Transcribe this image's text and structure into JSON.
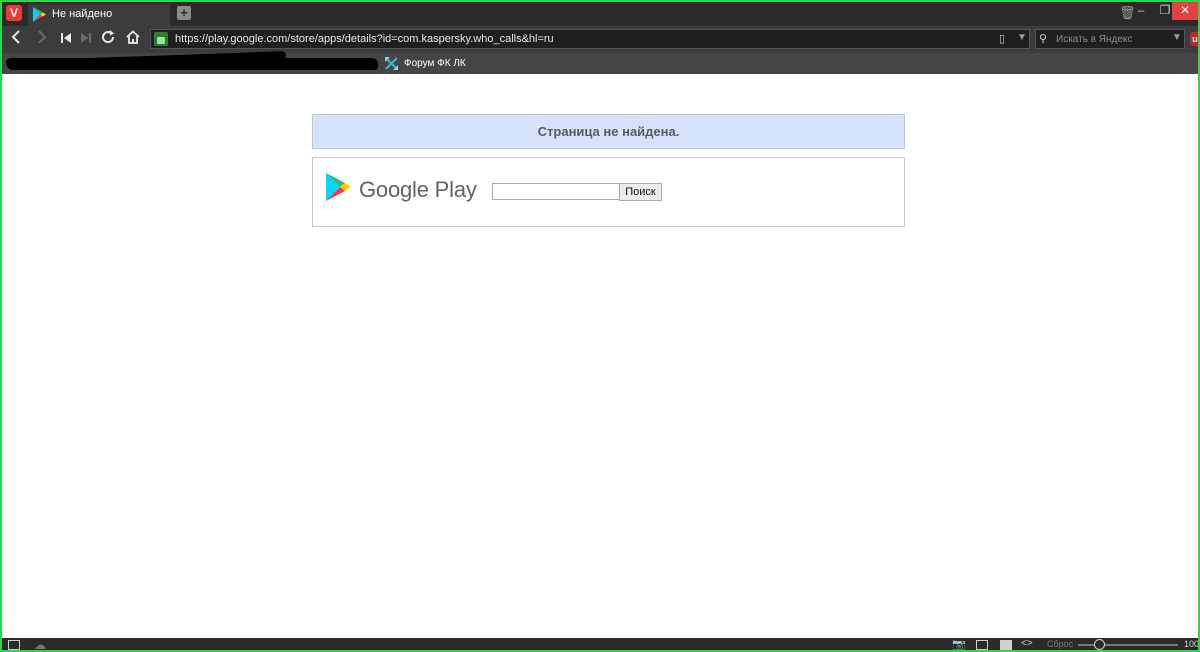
{
  "browser": {
    "logo_letter": "V",
    "tab_title": "Не найдено",
    "new_tab_symbol": "+",
    "url": "https://play.google.com/store/apps/details?id=com.kaspersky.who_calls&hl=ru",
    "search_placeholder": "Искать в Яндекс",
    "extension_badge": "u",
    "window_controls": {
      "minimize": "–",
      "maximize": "❐",
      "close": "✕"
    }
  },
  "bookmarks": {
    "items": [
      {
        "label": "Форум ФК ЛК",
        "icon": "cross-arrows-icon"
      }
    ]
  },
  "page": {
    "notice_text": "Страница не найдена.",
    "brand": "Google Play",
    "search_value": "",
    "search_button": "Поиск"
  },
  "statusbar": {
    "reset_label": "Сброс",
    "zoom_level": "100"
  },
  "colors": {
    "frame_border": "#2fd54a",
    "notice_bg": "#d7e3fb",
    "close_button": "#e04343",
    "vivaldi_red": "#ef3939"
  }
}
